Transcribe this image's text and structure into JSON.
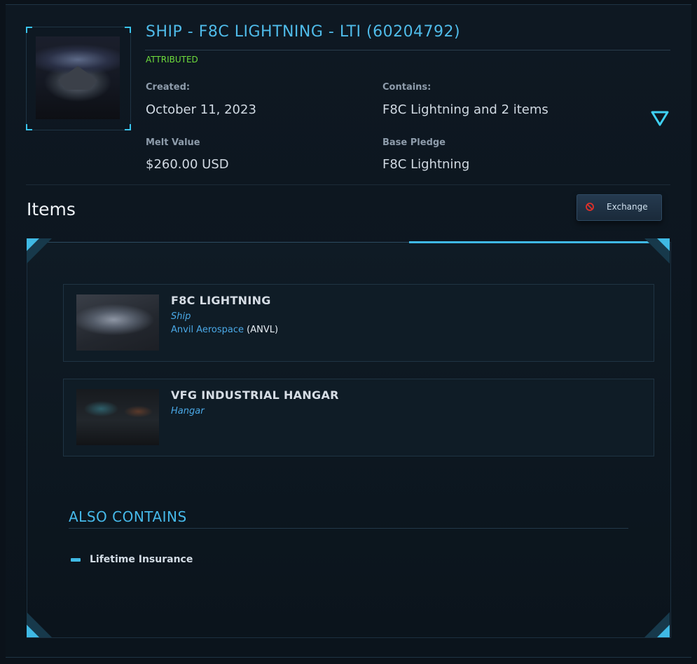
{
  "pledge": {
    "title": "SHIP - F8C LIGHTNING - LTI (60204792)",
    "status": "ATTRIBUTED",
    "created_label": "Created:",
    "created_value": "October 11, 2023",
    "contains_label": "Contains:",
    "contains_value": "F8C Lightning and 2 items",
    "melt_label": "Melt Value",
    "melt_value": "$260.00 USD",
    "base_label": "Base Pledge",
    "base_value": "F8C Lightning"
  },
  "items_section": {
    "heading": "Items",
    "exchange_label": "Exchange",
    "items": [
      {
        "name": "F8C LIGHTNING",
        "type": "Ship",
        "manufacturer": "Anvil Aerospace",
        "manufacturer_code": "(ANVL)"
      },
      {
        "name": "VFG INDUSTRIAL HANGAR",
        "type": "Hangar"
      }
    ]
  },
  "also_contains": {
    "heading": "ALSO CONTAINS",
    "items": [
      "Lifetime Insurance"
    ]
  },
  "colors": {
    "accent": "#3fb9e4",
    "status_green": "#6edc3c",
    "link_blue": "#4aa8e6",
    "ban_red": "#e0302a"
  },
  "icons": {
    "expand": "triangle-down-icon",
    "exchange": "ban-icon",
    "bullet": "dash-icon"
  }
}
